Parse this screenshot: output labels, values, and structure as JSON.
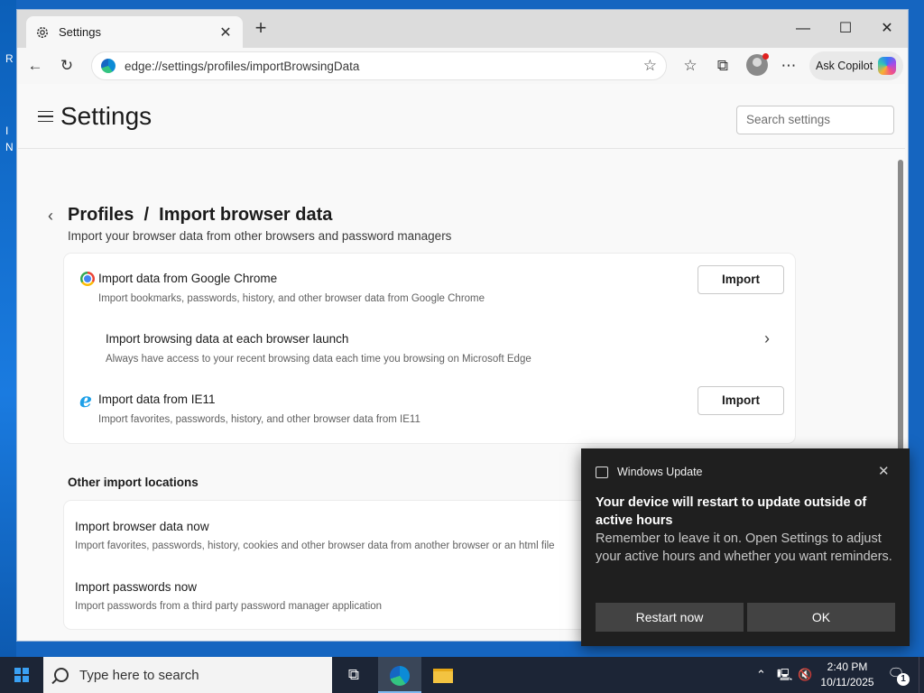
{
  "desktop": {
    "glyphs": [
      "R",
      "I",
      "N"
    ]
  },
  "browser": {
    "tab_title": "Settings",
    "new_tab_symbol": "+",
    "address": "edge://settings/profiles/importBrowsingData",
    "copilot_label": "Ask Copilot",
    "window_controls": {
      "minimize": "—",
      "maximize": "☐",
      "close": "✕"
    }
  },
  "settings": {
    "title": "Settings",
    "search_placeholder": "Search settings",
    "breadcrumb": "Profiles  /  Import browser data",
    "subtitle": "Import your browser data from other browsers and password managers",
    "import_rows": [
      {
        "title": "Import data from Google Chrome",
        "desc": "Import bookmarks, passwords, history, and other browser data from Google Chrome",
        "button": "Import",
        "icon": "chrome-icon"
      },
      {
        "title": "Import browsing data at each browser launch",
        "desc": "Always have access to your recent browsing data each time you browsing on Microsoft Edge",
        "icon": "chevron-right-icon"
      },
      {
        "title": "Import data from IE11",
        "desc": "Import favorites, passwords, history, and other browser data from IE11",
        "button": "Import",
        "icon": "ie-icon"
      }
    ],
    "other_section_title": "Other import locations",
    "other_rows": [
      {
        "title": "Import browser data now",
        "desc": "Import favorites, passwords, history, cookies and other browser data from another browser or an html file"
      },
      {
        "title": "Import passwords now",
        "desc": "Import passwords from a third party password manager application"
      }
    ]
  },
  "toast": {
    "app_name": "Windows Update",
    "headline": "Your device will restart to update outside of active hours",
    "body": "Remember to leave it on. Open Settings to adjust your active hours and whether you want reminders.",
    "primary_button": "Restart now",
    "secondary_button": "OK"
  },
  "taskbar": {
    "search_placeholder": "Type here to search",
    "time": "2:40 PM",
    "date": "10/11/2025",
    "notification_count": "1"
  }
}
